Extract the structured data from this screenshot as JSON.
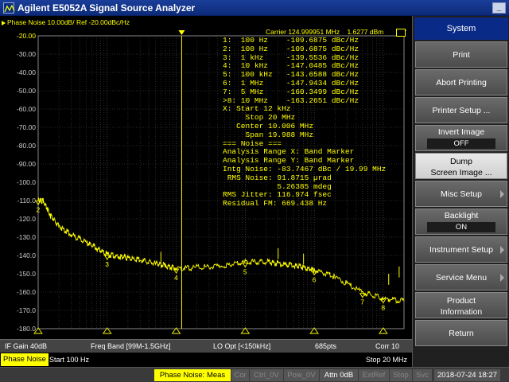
{
  "window": {
    "title": "Agilent E5052A Signal Source Analyzer",
    "minimize_label": "_"
  },
  "trace": {
    "header": "Phase Noise 10.00dB/ Ref -20.00dBc/Hz",
    "carrier": "Carrier 124.999951 MHz",
    "carrier_power": "1.6277 dBm",
    "markers": [
      "1:  100 Hz    -109.6875 dBc/Hz",
      "2:  100 Hz    -109.6875 dBc/Hz",
      "3:  1 kHz     -139.5536 dBc/Hz",
      "4:  10 kHz    -147.0485 dBc/Hz",
      "5:  100 kHz   -143.6588 dBc/Hz",
      "6:  1 MHz     -147.9434 dBc/Hz",
      "7:  5 MHz     -160.3499 dBc/Hz",
      ">8: 10 MHz    -163.2651 dBc/Hz"
    ],
    "range": [
      "X: Start 12 kHz",
      "     Stop 20 MHz",
      "   Center 10.006 MHz",
      "     Span 19.988 MHz"
    ],
    "noise": [
      "=== Noise ===",
      "Analysis Range X: Band Marker",
      "Analysis Range Y: Band Marker",
      "Intg Noise: -83.7467 dBc / 19.99 MHz",
      " RMS Noise: 91.8715 µrad",
      "            5.26385 mdeg",
      "RMS Jitter: 116.974 fsec",
      "Residual FM: 669.438 Hz"
    ]
  },
  "chart_data": {
    "type": "line",
    "title": "",
    "xlabel": "",
    "ylabel": "",
    "x_scale": "log",
    "xlim": [
      100,
      20000000
    ],
    "ylim": [
      -180,
      -20
    ],
    "yticks": [
      "-20.00",
      "-30.00",
      "-40.00",
      "-50.00",
      "-60.00",
      "-70.00",
      "-80.00",
      "-90.00",
      "-100.0",
      "-110.0",
      "-120.0",
      "-130.0",
      "-140.0",
      "-150.0",
      "-160.0",
      "-170.0",
      "-180.0"
    ],
    "grid": true,
    "series": [
      {
        "color": "#ffff00",
        "x": [
          100,
          120,
          150,
          200,
          300,
          500,
          700,
          1000,
          1500,
          2000,
          3000,
          5000,
          7000,
          10000,
          20000,
          50000,
          100000,
          200000,
          300000,
          500000,
          700000,
          1000000,
          2000000,
          5000000,
          10000000,
          20000000
        ],
        "y": [
          -109.7,
          -110.5,
          -118,
          -124,
          -128.5,
          -133,
          -136,
          -139.6,
          -140.5,
          -141.5,
          -142.5,
          -144.5,
          -145.5,
          -147,
          -146.5,
          -145.5,
          -143.7,
          -143.5,
          -144.5,
          -145.5,
          -146.5,
          -148,
          -151.5,
          -160.3,
          -163.3,
          -165
        ]
      }
    ],
    "markers": [
      {
        "label": "2",
        "x": 100,
        "y": -109.7
      },
      {
        "label": "3",
        "x": 1000,
        "y": -139.6
      },
      {
        "label": "4",
        "x": 10000,
        "y": -147
      },
      {
        "label": "5",
        "x": 100000,
        "y": -143.7
      },
      {
        "label": "6",
        "x": 1000000,
        "y": -148
      },
      {
        "label": "7",
        "x": 5000000,
        "y": -160.3
      },
      {
        "label": "8",
        "x": 10000000,
        "y": -163.3
      }
    ],
    "band_markers_x": [
      12000,
      20000000
    ]
  },
  "status": {
    "if_gain": "IF Gain 40dB",
    "freq_band": "Freq Band [99M-1.5GHz]",
    "lo_opt": "LO Opt [<150kHz]",
    "points": "685pts",
    "corr": "Corr 10"
  },
  "sweep": {
    "trace_name": "Phase Noise",
    "start": "Start 100 Hz",
    "stop": "Stop 20 MHz"
  },
  "bottom": {
    "meas": "Phase Noise: Meas",
    "cor": "Cor",
    "ctrl": "Ctrl_0V",
    "pow": "Pow_0V",
    "atten": "Attn 0dB",
    "extref": "ExtRef",
    "stop": "Stop",
    "svc": "Svc",
    "datetime": "2018-07-24 18:27"
  },
  "softkeys": {
    "title": "System",
    "print": "Print",
    "abort": "Abort Printing",
    "printer_setup": "Printer Setup ...",
    "invert_image": "Invert Image",
    "invert_value": "OFF",
    "dump_line1": "Dump",
    "dump_line2": "Screen Image ...",
    "misc": "Misc Setup",
    "backlight": "Backlight",
    "backlight_value": "ON",
    "instrument": "Instrument Setup",
    "service": "Service Menu",
    "product_line1": "Product",
    "product_line2": "Information",
    "return": "Return"
  }
}
